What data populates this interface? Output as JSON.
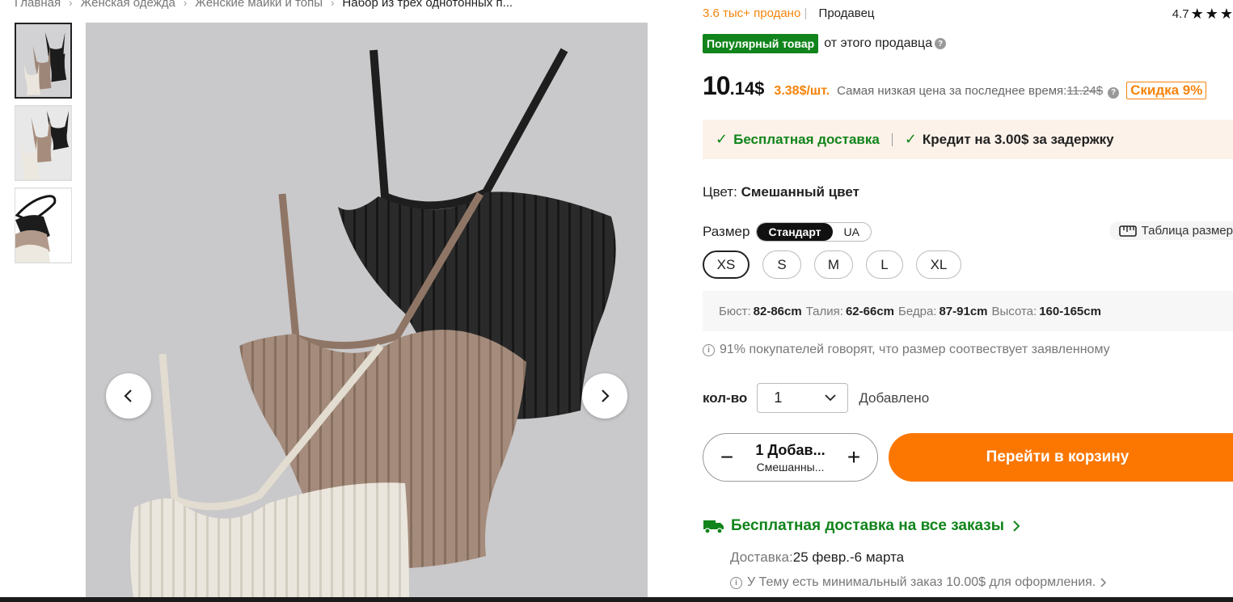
{
  "breadcrumb": [
    "Главная",
    "Женская одежда",
    "Женские майки и топы",
    "Набор из трех однотонных п..."
  ],
  "seller_row": {
    "sold": "3.6 тыс+ продано",
    "seller": "Продавец",
    "rating": "4.7"
  },
  "popular": {
    "badge": "Популярный товар",
    "text": "от этого продавца"
  },
  "price": {
    "whole": "10",
    "rest": ".14$",
    "unit": "3.38$/шт.",
    "lowest_label": "Самая низкая цена за последнее время:",
    "old_price": "11.24$",
    "discount": "Скидка 9%"
  },
  "delivery": {
    "free": "Бесплатная доставка",
    "credit": "Кредит на 3.00$ за задержку"
  },
  "color": {
    "label": "Цвет:",
    "value": "Смешанный цвет"
  },
  "size": {
    "label": "Размер",
    "toggle": [
      "Стандарт",
      "UA"
    ],
    "table_label": "Таблица размер",
    "options": [
      "XS",
      "S",
      "M",
      "L",
      "XL"
    ],
    "selected": "XS"
  },
  "measurements": [
    {
      "label": "Бюст:",
      "value": "82-86cm"
    },
    {
      "label": "Талия:",
      "value": "62-66cm"
    },
    {
      "label": "Бедра:",
      "value": "87-91cm"
    },
    {
      "label": "Высота:",
      "value": "160-165cm"
    }
  ],
  "fit_note": "91% покупателей говорят, что размер соотвествует заявленному",
  "quantity": {
    "label": "кол-во",
    "value": "1",
    "added": "Добавлено"
  },
  "cart_stepper": {
    "line1": "1 Добав...",
    "line2": "Смешанны..."
  },
  "go_to_cart": "Перейти в корзину",
  "shipping": {
    "free_all": "Бесплатная доставка на все заказы",
    "date_label": "Доставка:",
    "date_value": "25 февр.-6 марта",
    "min_order": "У Тему есть минимальный заказ 10.00$ для оформления."
  },
  "colors": {
    "accent_orange": "#fb7701",
    "green": "#11841b",
    "delivery_bg": "#fdf2e9"
  }
}
